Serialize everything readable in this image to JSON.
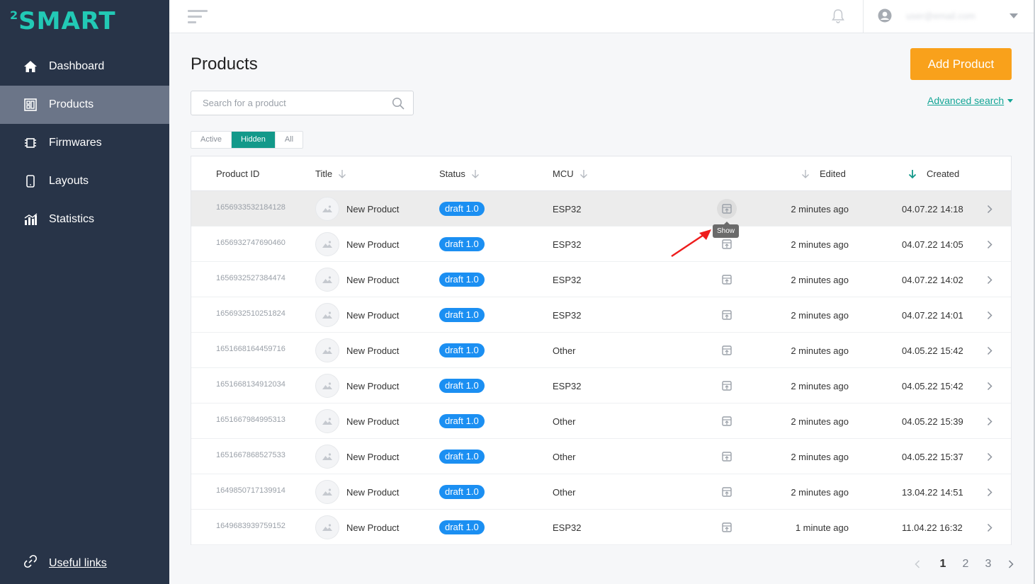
{
  "brand": {
    "logo_sup": "2",
    "logo_text": "SMART",
    "color": "#22c9b5"
  },
  "sidebar": {
    "items": [
      {
        "label": "Dashboard",
        "icon": "home-icon"
      },
      {
        "label": "Products",
        "icon": "products-icon",
        "active": true
      },
      {
        "label": "Firmwares",
        "icon": "chip-icon"
      },
      {
        "label": "Layouts",
        "icon": "phone-icon"
      },
      {
        "label": "Statistics",
        "icon": "bar-chart-icon"
      }
    ],
    "useful_links": "Useful links"
  },
  "topbar": {
    "user_email": "user@email.com"
  },
  "page": {
    "title": "Products",
    "add_button": "Add Product",
    "search_placeholder": "Search for a product",
    "advanced_search": "Advanced search",
    "filters": [
      "Active",
      "Hidden",
      "All"
    ],
    "active_filter": "Hidden"
  },
  "table": {
    "headers": {
      "product_id": "Product ID",
      "title": "Title",
      "status": "Status",
      "mcu": "MCU",
      "edited": "Edited",
      "created": "Created"
    },
    "rows": [
      {
        "id": "1656933532184128",
        "title": "New Product",
        "status": "draft 1.0",
        "mcu": "ESP32",
        "edited": "2 minutes ago",
        "created": "04.07.22 14:18"
      },
      {
        "id": "1656932747690460",
        "title": "New Product",
        "status": "draft 1.0",
        "mcu": "ESP32",
        "edited": "2 minutes ago",
        "created": "04.07.22 14:05"
      },
      {
        "id": "1656932527384474",
        "title": "New Product",
        "status": "draft 1.0",
        "mcu": "ESP32",
        "edited": "2 minutes ago",
        "created": "04.07.22 14:02"
      },
      {
        "id": "1656932510251824",
        "title": "New Product",
        "status": "draft 1.0",
        "mcu": "ESP32",
        "edited": "2 minutes ago",
        "created": "04.07.22 14:01"
      },
      {
        "id": "1651668164459716",
        "title": "New Product",
        "status": "draft 1.0",
        "mcu": "Other",
        "edited": "2 minutes ago",
        "created": "04.05.22 15:42"
      },
      {
        "id": "1651668134912034",
        "title": "New Product",
        "status": "draft 1.0",
        "mcu": "ESP32",
        "edited": "2 minutes ago",
        "created": "04.05.22 15:42"
      },
      {
        "id": "1651667984995313",
        "title": "New Product",
        "status": "draft 1.0",
        "mcu": "Other",
        "edited": "2 minutes ago",
        "created": "04.05.22 15:39"
      },
      {
        "id": "1651667868527533",
        "title": "New Product",
        "status": "draft 1.0",
        "mcu": "Other",
        "edited": "2 minutes ago",
        "created": "04.05.22 15:37"
      },
      {
        "id": "1649850717139914",
        "title": "New Product",
        "status": "draft 1.0",
        "mcu": "Other",
        "edited": "2 minutes ago",
        "created": "13.04.22 14:51"
      },
      {
        "id": "1649683939759152",
        "title": "New Product",
        "status": "draft 1.0",
        "mcu": "ESP32",
        "edited": "1 minute ago",
        "created": "11.04.22 16:32"
      }
    ],
    "tooltip": "Show"
  },
  "pagination": {
    "pages": [
      "1",
      "2",
      "3"
    ],
    "current": "1"
  },
  "colors": {
    "accent_orange": "#f9a11b",
    "teal": "#13998a",
    "badge_blue": "#1b8ff2",
    "sidebar_bg": "#283448"
  }
}
